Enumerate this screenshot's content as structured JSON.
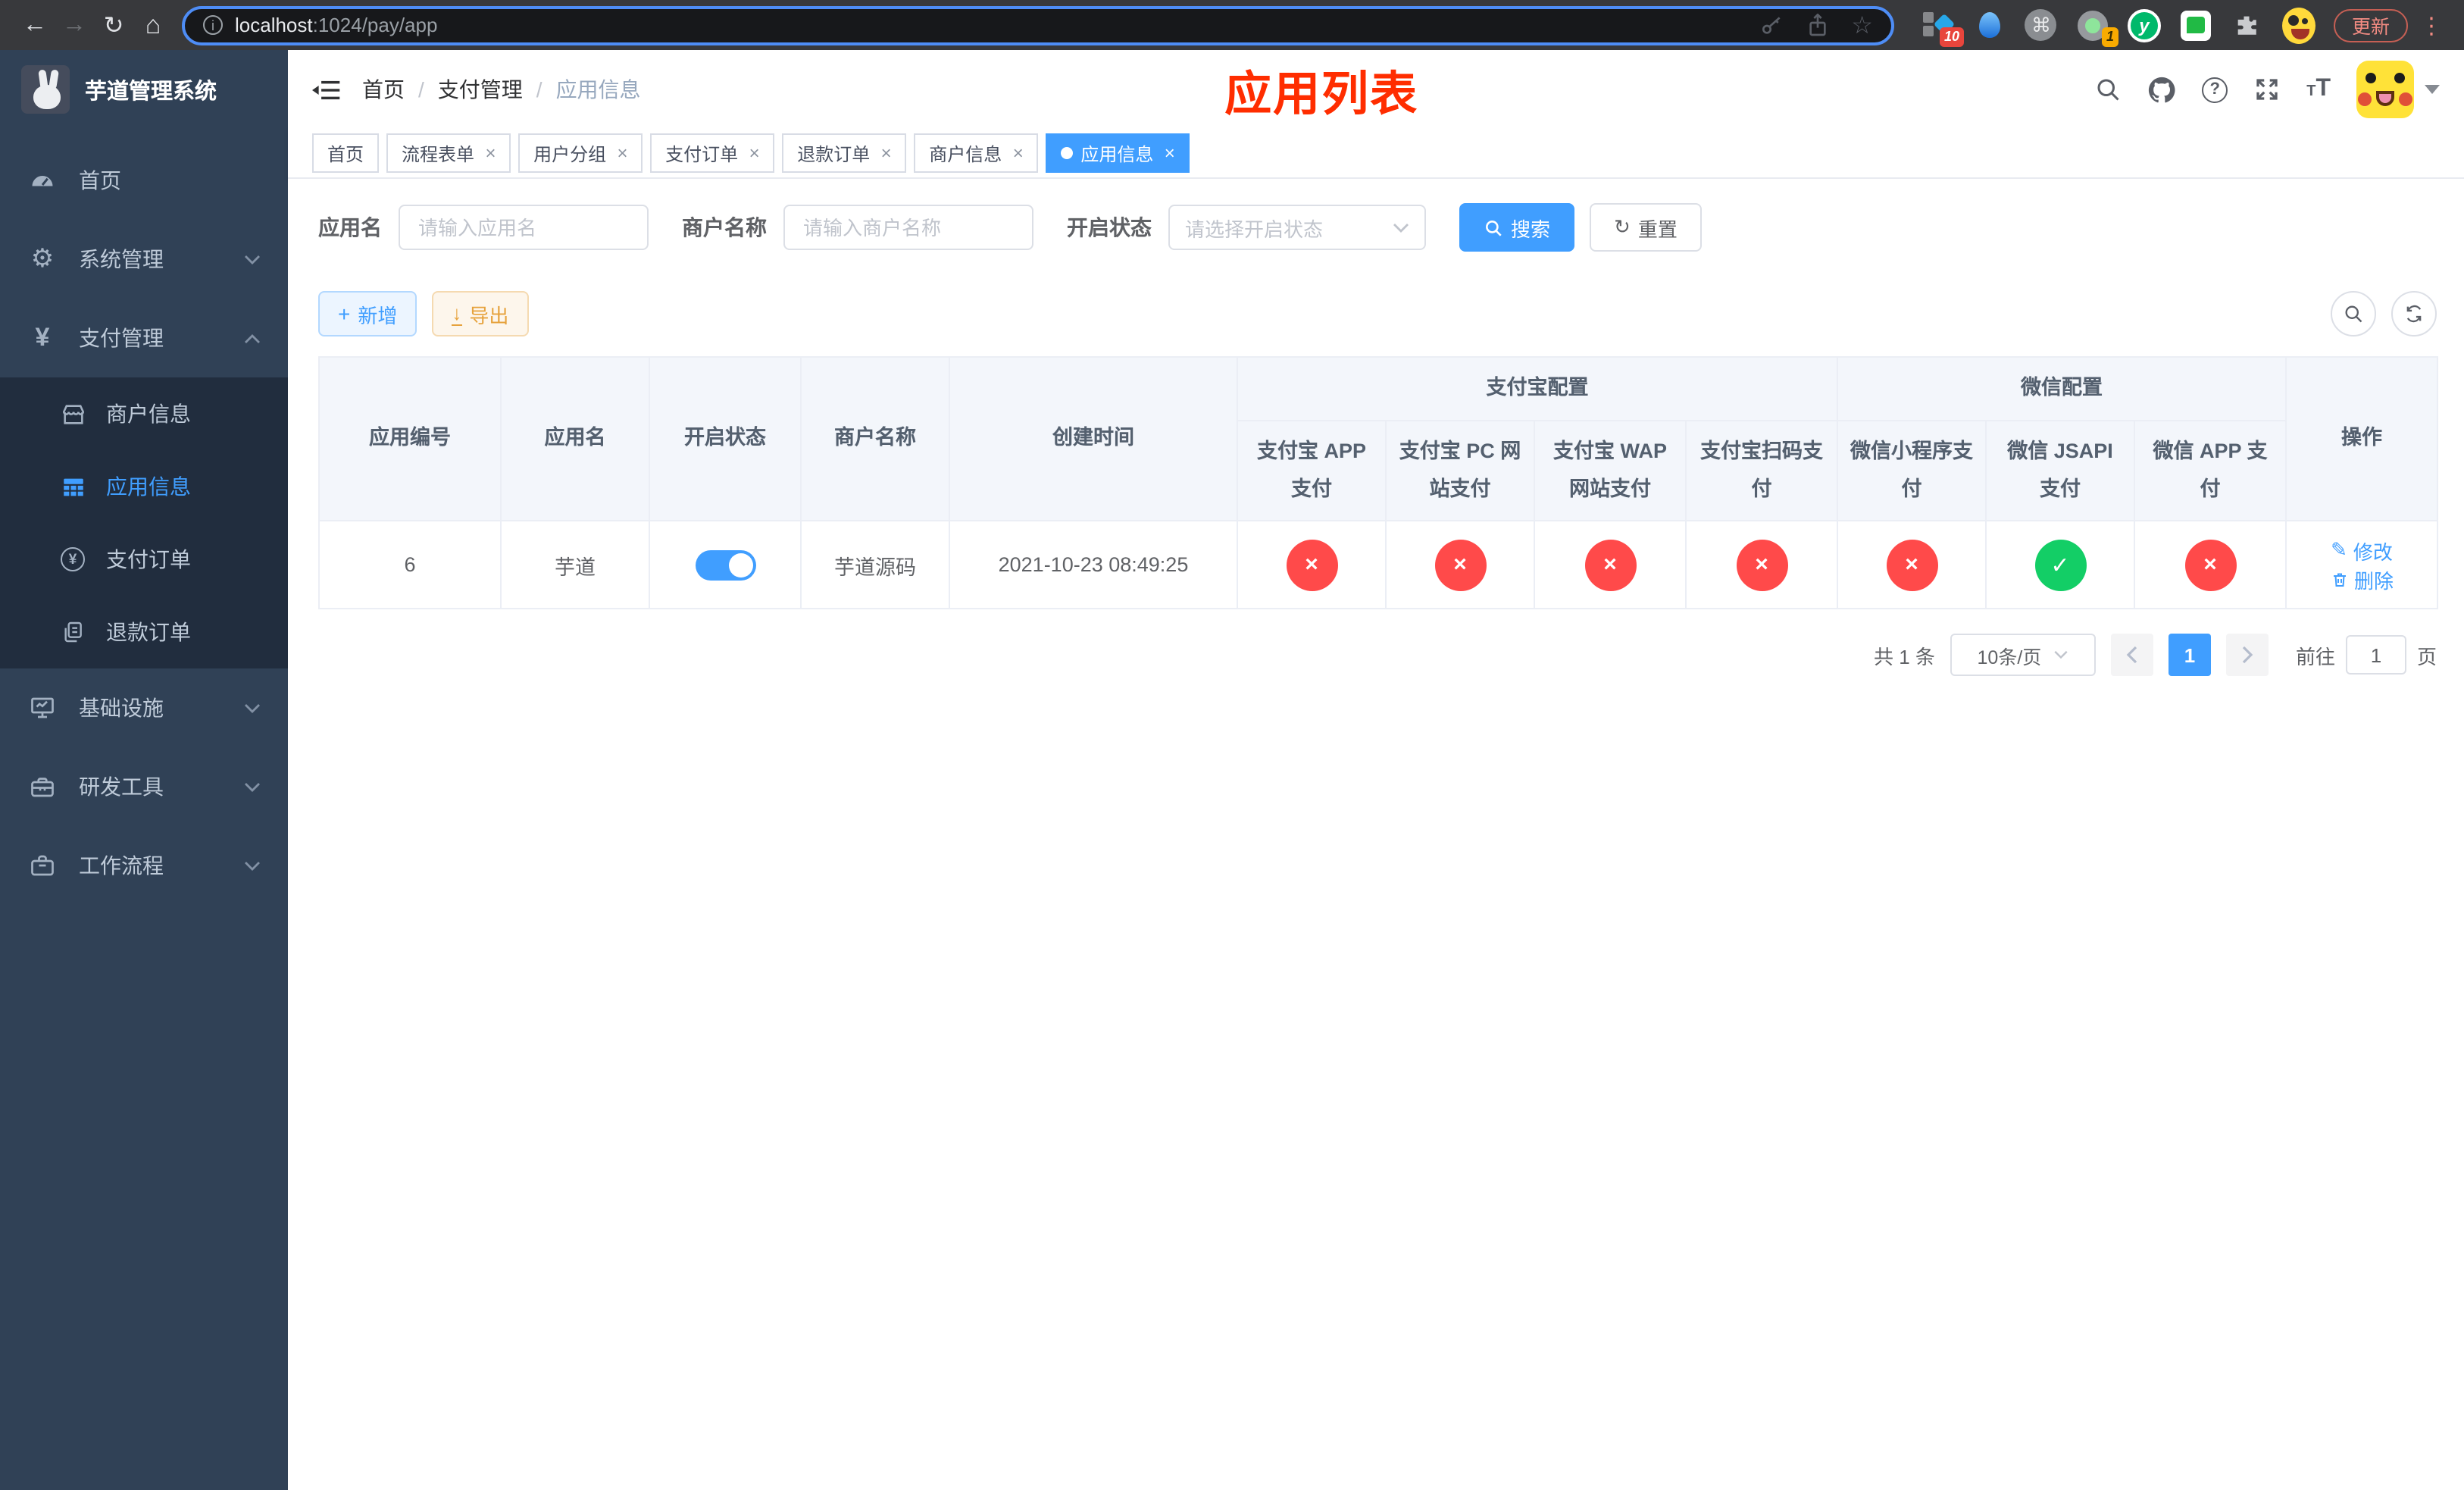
{
  "browser": {
    "url_host": "localhost",
    "url_rest": ":1024/pay/app",
    "update_label": "更新",
    "extensions": {
      "blocks_badge": "10",
      "circle_badge": "1",
      "yuque_letter": "y"
    }
  },
  "sidebar": {
    "title": "芋道管理系统",
    "items": [
      {
        "label": "首页"
      },
      {
        "label": "系统管理"
      },
      {
        "label": "支付管理"
      },
      {
        "label": "基础设施"
      },
      {
        "label": "研发工具"
      },
      {
        "label": "工作流程"
      }
    ],
    "submenu": [
      {
        "label": "商户信息"
      },
      {
        "label": "应用信息"
      },
      {
        "label": "支付订单"
      },
      {
        "label": "退款订单"
      }
    ]
  },
  "header": {
    "breadcrumb": [
      "首页",
      "支付管理",
      "应用信息"
    ],
    "watermark": "应用列表"
  },
  "tabs": [
    {
      "label": "首页"
    },
    {
      "label": "流程表单"
    },
    {
      "label": "用户分组"
    },
    {
      "label": "支付订单"
    },
    {
      "label": "退款订单"
    },
    {
      "label": "商户信息"
    },
    {
      "label": "应用信息"
    }
  ],
  "filters": {
    "app_name_label": "应用名",
    "app_name_placeholder": "请输入应用名",
    "merchant_label": "商户名称",
    "merchant_placeholder": "请输入商户名称",
    "status_label": "开启状态",
    "status_placeholder": "请选择开启状态",
    "search_label": "搜索",
    "reset_label": "重置"
  },
  "actions": {
    "add_label": "新增",
    "export_label": "导出"
  },
  "table": {
    "groups": {
      "alipay": "支付宝配置",
      "wechat": "微信配置"
    },
    "columns": [
      "应用编号",
      "应用名",
      "开启状态",
      "商户名称",
      "创建时间",
      "支付宝 APP 支付",
      "支付宝 PC 网站支付",
      "支付宝 WAP 网站支付",
      "支付宝扫码支付",
      "微信小程序支付",
      "微信 JSAPI 支付",
      "微信 APP 支付",
      "操作"
    ],
    "status_icons": {
      "yes": "✓",
      "no": "×"
    },
    "row": {
      "id": "6",
      "name": "芋道",
      "enabled": true,
      "merchant": "芋道源码",
      "created": "2021-10-23 08:49:25",
      "statuses": [
        false,
        false,
        false,
        false,
        false,
        true,
        false
      ],
      "edit_label": "修改",
      "delete_label": "删除"
    }
  },
  "pagination": {
    "total": "共 1 条",
    "page_size": "10条/页",
    "current_page": "1",
    "go_prefix": "前往",
    "go_value": "1",
    "go_suffix": "页"
  },
  "colors": {
    "accent": "#409eff",
    "success": "#13ce66",
    "danger": "#ff4a4a",
    "watermark_red": "#ff2d00",
    "sidebar_bg": "#304156",
    "submenu_bg": "#212d3e"
  }
}
